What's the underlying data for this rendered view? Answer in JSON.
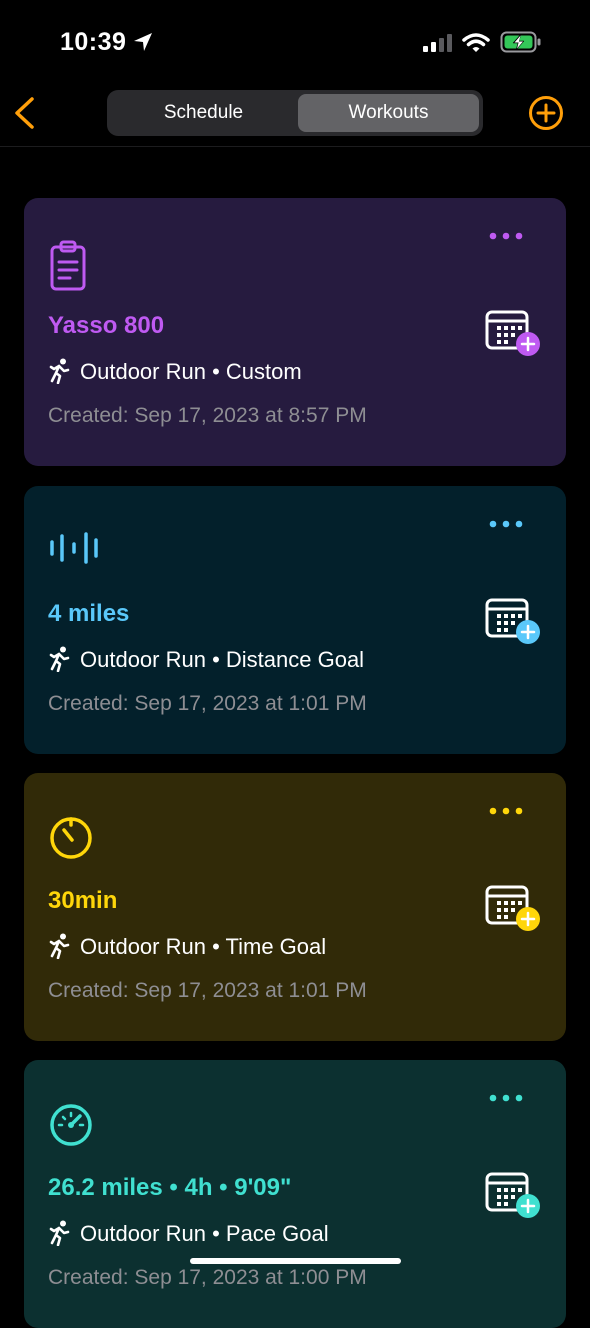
{
  "status_bar": {
    "time": "10:39"
  },
  "nav": {
    "segments": {
      "schedule": "Schedule",
      "workouts": "Workouts"
    },
    "accent": "#ff9f0a"
  },
  "cards": [
    {
      "name": "Yasso 800",
      "subtitle": "Outdoor Run • Custom",
      "created": "Created: Sep 17, 2023 at 8:57 PM",
      "icon": "clipboard-icon",
      "accent": "#bf5af2",
      "bg": "#261b3f"
    },
    {
      "name": "4 miles",
      "subtitle": "Outdoor Run • Distance Goal",
      "created": "Created: Sep 17, 2023 at 1:01 PM",
      "icon": "distance-icon",
      "accent": "#5ac8fa",
      "bg": "#03202b"
    },
    {
      "name": "30min",
      "subtitle": "Outdoor Run • Time Goal",
      "created": "Created: Sep 17, 2023 at 1:01 PM",
      "icon": "timer-icon",
      "accent": "#ffd60a",
      "bg": "#312a08"
    },
    {
      "name": "26.2 miles • 4h • 9'09\"",
      "subtitle": "Outdoor Run • Pace Goal",
      "created": "Created: Sep 17, 2023 at 1:00 PM",
      "icon": "speedometer-icon",
      "accent": "#40e0d0",
      "bg": "#0c3030"
    }
  ]
}
